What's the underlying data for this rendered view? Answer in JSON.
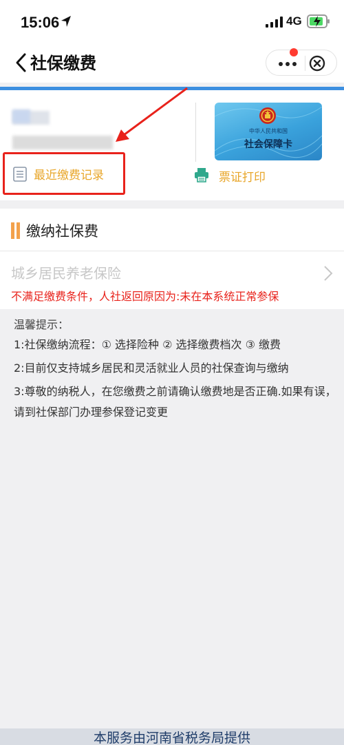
{
  "status_bar": {
    "time": "15:06",
    "network": "4G"
  },
  "nav": {
    "title": "社保缴费"
  },
  "card": {
    "record_label": "最近缴费记录",
    "print_label": "票证打印",
    "card_subtitle": "中华人民共和国",
    "card_title": "社会保障卡"
  },
  "pay": {
    "heading": "缴纳社保费",
    "insurance_item": "城乡居民养老保险",
    "error_message": "不满足缴费条件，人社返回原因为:未在本系统正常参保"
  },
  "tips": {
    "title": "温馨提示：",
    "items": [
      "1:社保缴纳流程：① 选择险种 ② 选择缴费档次 ③ 缴费",
      "2:目前仅支持城乡居民和灵活就业人员的社保查询与缴纳",
      "3:尊敬的纳税人，在您缴费之前请确认缴费地是否正确.如果有误，请到社保部门办理参保登记变更"
    ]
  },
  "footer": {
    "text": "本服务由河南省税务局提供"
  },
  "colors": {
    "accent_blue": "#3c8fe0",
    "label_orange": "#e8a62a",
    "error_red": "#e8221b",
    "badge_red": "#ff3b30"
  }
}
